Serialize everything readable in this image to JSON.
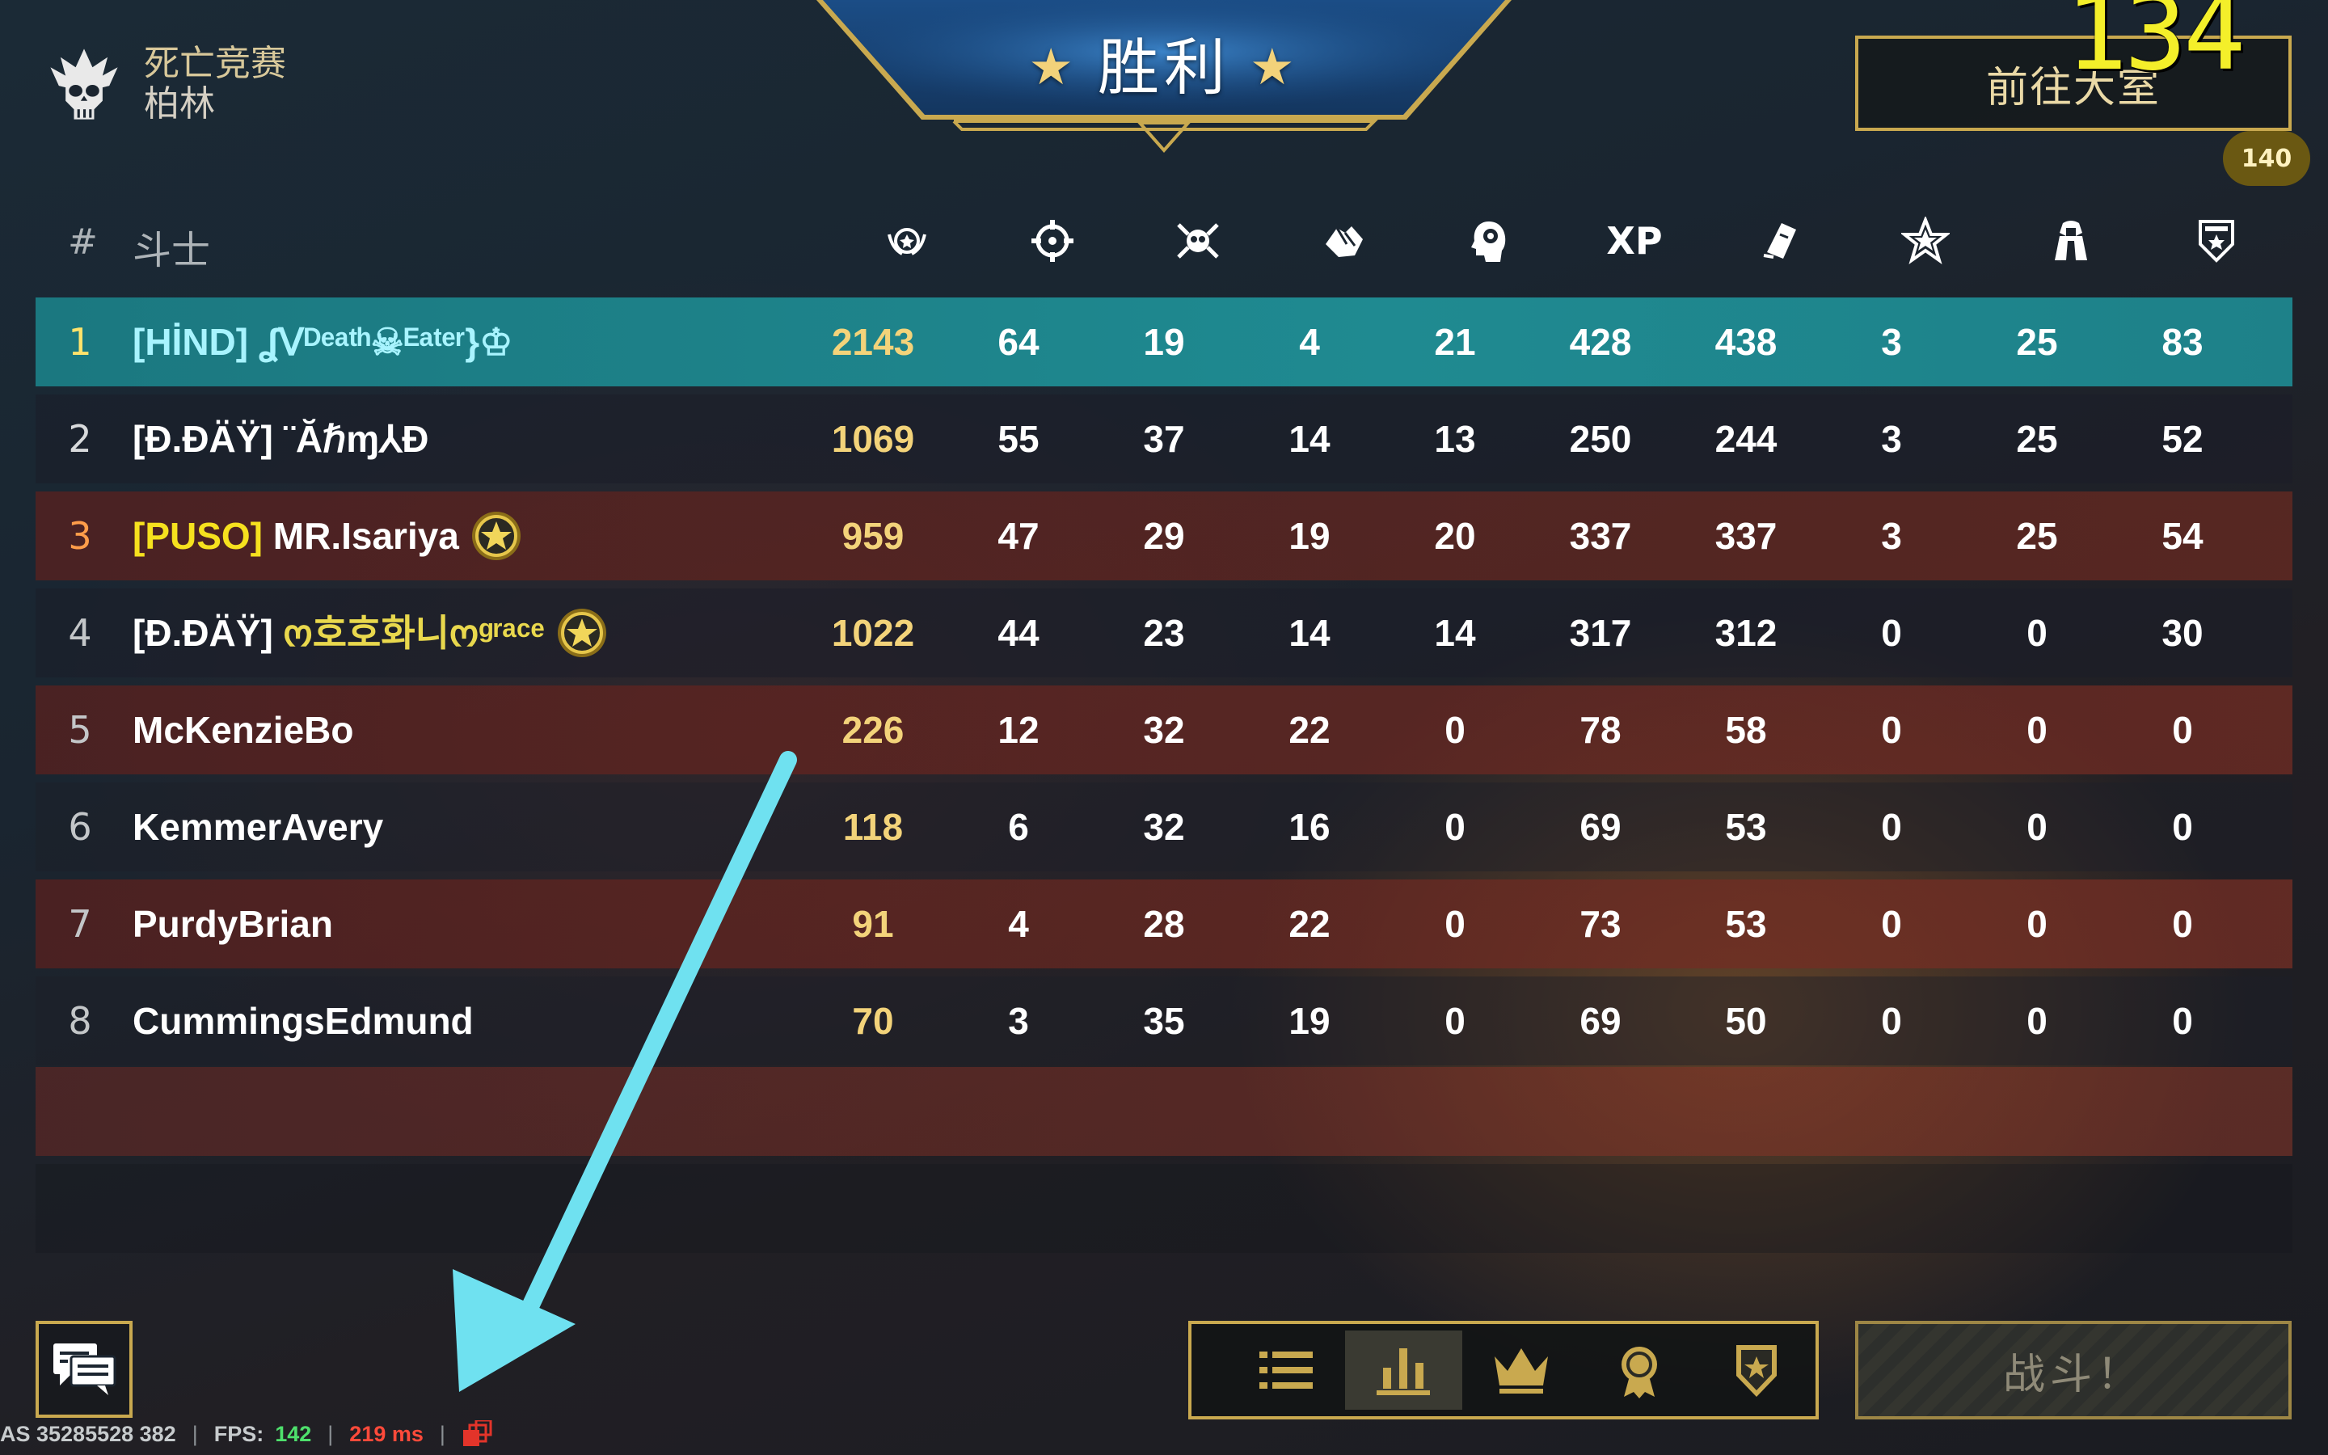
{
  "mode": {
    "name": "死亡竞赛",
    "map": "柏林"
  },
  "banner": {
    "title": "胜利"
  },
  "top_right": {
    "lobby_button": "前往大室",
    "timer": "134",
    "level_badge": "140"
  },
  "table": {
    "header": {
      "rank": "#",
      "fighter": "斗士",
      "xp": "XP"
    },
    "columns_icons": [
      "score-icon",
      "kills-icon",
      "deaths-icon",
      "assists-icon",
      "headshots-icon",
      "xp-icon",
      "credits-icon",
      "stars-icon",
      "streak-icon",
      "rank-shield-icon"
    ],
    "rows": [
      {
        "rank": "1",
        "tag": "[HİND]",
        "name": "ʆᐯᴰᵉᵃᵗʰ☠ᴱᵃᵗᵉʳ}♔",
        "medal": false,
        "stats": [
          "2143",
          "64",
          "19",
          "4",
          "21",
          "428",
          "438",
          "3",
          "25",
          "83"
        ]
      },
      {
        "rank": "2",
        "tag": "[Ð.ÐÄŸ]",
        "name": "¨Ăℏɱ⅄Đ",
        "medal": false,
        "stats": [
          "1069",
          "55",
          "37",
          "14",
          "13",
          "250",
          "244",
          "3",
          "25",
          "52"
        ]
      },
      {
        "rank": "3",
        "tag": "[PUSO]",
        "name": "MR.Isariya",
        "medal": true,
        "stats": [
          "959",
          "47",
          "29",
          "19",
          "20",
          "337",
          "337",
          "3",
          "25",
          "54"
        ]
      },
      {
        "rank": "4",
        "tag": "[Ð.ÐÄŸ]",
        "name": "ო호호화니ოᵍʳᵃᶜᵉ",
        "medal": true,
        "stats": [
          "1022",
          "44",
          "23",
          "14",
          "14",
          "317",
          "312",
          "0",
          "0",
          "30"
        ]
      },
      {
        "rank": "5",
        "tag": "",
        "name": "McKenzieBo",
        "medal": false,
        "stats": [
          "226",
          "12",
          "32",
          "22",
          "0",
          "78",
          "58",
          "0",
          "0",
          "0"
        ]
      },
      {
        "rank": "6",
        "tag": "",
        "name": "KemmerAvery",
        "medal": false,
        "stats": [
          "118",
          "6",
          "32",
          "16",
          "0",
          "69",
          "53",
          "0",
          "0",
          "0"
        ]
      },
      {
        "rank": "7",
        "tag": "",
        "name": "PurdyBrian",
        "medal": false,
        "stats": [
          "91",
          "4",
          "28",
          "22",
          "0",
          "73",
          "53",
          "0",
          "0",
          "0"
        ]
      },
      {
        "rank": "8",
        "tag": "",
        "name": "CummingsEdmund",
        "medal": false,
        "stats": [
          "70",
          "3",
          "35",
          "19",
          "0",
          "69",
          "50",
          "0",
          "0",
          "0"
        ]
      }
    ]
  },
  "status": {
    "server": "AS 35285528 382",
    "fps_label": "FPS:",
    "fps_value": "142",
    "ping": "219 ms"
  },
  "nav": {
    "tabs": [
      "list-icon",
      "bar-chart-icon",
      "crown-icon",
      "medal-icon",
      "shield-star-icon"
    ],
    "active": 1
  },
  "fight_button": "战斗！",
  "colors": {
    "gold": "#c9a94f",
    "highlight_row": "#1f7f86",
    "score": "#f3d37a",
    "arrow": "#6fe1f0"
  }
}
